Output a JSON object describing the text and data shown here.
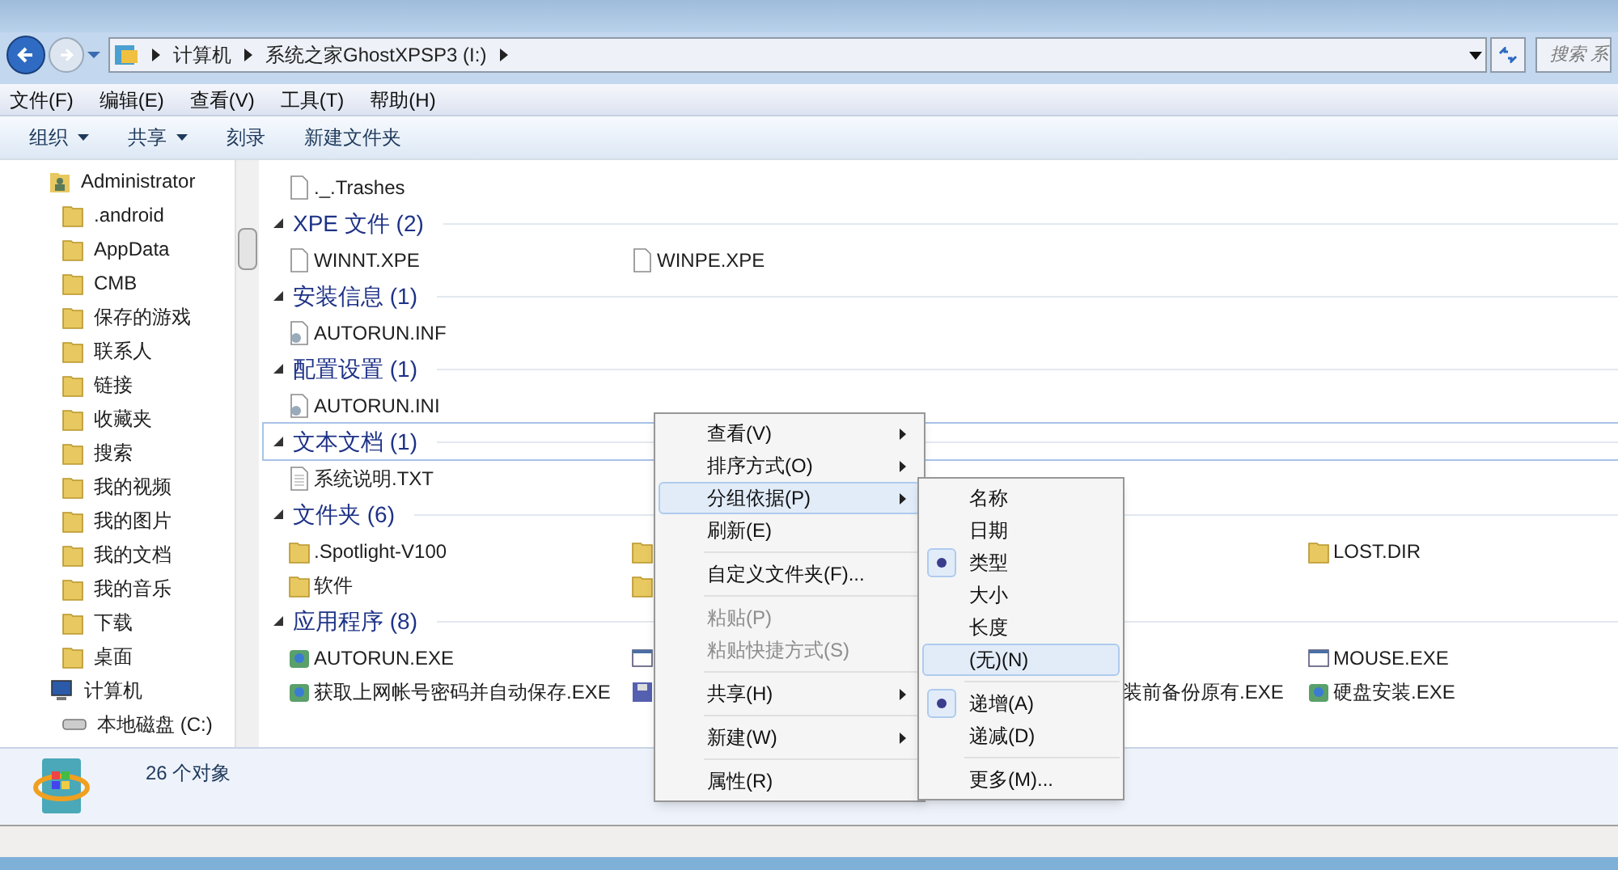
{
  "address_bar": {
    "crumbs": [
      "计算机",
      "系统之家GhostXPSP3 (I:)"
    ]
  },
  "search": {
    "placeholder": "搜索 系"
  },
  "menu_bar": [
    "文件(F)",
    "编辑(E)",
    "查看(V)",
    "工具(T)",
    "帮助(H)"
  ],
  "toolbar": [
    {
      "label": "组织",
      "dropdown": true
    },
    {
      "label": "共享",
      "dropdown": true
    },
    {
      "label": "刻录",
      "dropdown": false
    },
    {
      "label": "新建文件夹",
      "dropdown": false
    }
  ],
  "sidebar": {
    "items": [
      {
        "label": "Administrator",
        "kind": "user",
        "children": [
          {
            "label": ".android",
            "kind": "folder"
          },
          {
            "label": "AppData",
            "kind": "folder"
          },
          {
            "label": "CMB",
            "kind": "folder"
          },
          {
            "label": "保存的游戏",
            "kind": "folder"
          },
          {
            "label": "联系人",
            "kind": "folder"
          },
          {
            "label": "链接",
            "kind": "folder"
          },
          {
            "label": "收藏夹",
            "kind": "folder"
          },
          {
            "label": "搜索",
            "kind": "folder"
          },
          {
            "label": "我的视频",
            "kind": "folder"
          },
          {
            "label": "我的图片",
            "kind": "folder"
          },
          {
            "label": "我的文档",
            "kind": "folder"
          },
          {
            "label": "我的音乐",
            "kind": "folder"
          },
          {
            "label": "下载",
            "kind": "folder"
          },
          {
            "label": "桌面",
            "kind": "folder"
          }
        ]
      },
      {
        "label": "计算机",
        "kind": "computer",
        "children": [
          {
            "label": "本地磁盘 (C:)",
            "kind": "drive"
          }
        ]
      }
    ]
  },
  "top_rows": [
    [
      {
        "kind": "file",
        "name": "._.Trashes"
      }
    ]
  ],
  "groups": [
    {
      "title": "XPE 文件 (2)",
      "focused": false,
      "rows": [
        [
          {
            "kind": "file",
            "name": "WINNT.XPE"
          },
          {
            "kind": "file",
            "name": "WINPE.XPE"
          }
        ]
      ]
    },
    {
      "title": "安装信息 (1)",
      "focused": false,
      "rows": [
        [
          {
            "kind": "config",
            "name": "AUTORUN.INF"
          }
        ]
      ]
    },
    {
      "title": "配置设置 (1)",
      "focused": false,
      "rows": [
        [
          {
            "kind": "config",
            "name": "AUTORUN.INI"
          }
        ]
      ]
    },
    {
      "title": "文本文档 (1)",
      "focused": true,
      "rows": [
        [
          {
            "kind": "text",
            "name": "系统说明.TXT"
          }
        ]
      ]
    },
    {
      "title": "文件夹 (6)",
      "focused": false,
      "rows": [
        [
          {
            "kind": "folder",
            "name": ".Spotlight-V100"
          },
          {
            "kind": "folder"
          },
          "",
          {
            "kind": "folder",
            "name": "LOST.DIR"
          }
        ],
        [
          {
            "kind": "folder",
            "name": "软件"
          },
          {
            "kind": "folder"
          }
        ]
      ]
    },
    {
      "title": "应用程序 (8)",
      "focused": false,
      "rows": [
        [
          {
            "kind": "app",
            "name": "AUTORUN.EXE"
          },
          {
            "kind": "window"
          },
          "",
          {
            "kind": "window",
            "name": "MOUSE.EXE"
          }
        ],
        [
          {
            "kind": "app",
            "name": "获取上网帐号密码并自动保存.EXE"
          },
          {
            "kind": "disk"
          },
          {
            "kind": "label",
            "name": "装前备份原有.EXE"
          },
          {
            "kind": "app",
            "name": "硬盘安装.EXE"
          }
        ]
      ]
    }
  ],
  "context_menu": [
    {
      "kind": "item",
      "label": "查看(V)",
      "submenu": true,
      "disabled": false,
      "selected": false
    },
    {
      "kind": "item",
      "label": "排序方式(O)",
      "submenu": true,
      "disabled": false,
      "selected": false
    },
    {
      "kind": "item",
      "label": "分组依据(P)",
      "submenu": true,
      "disabled": false,
      "selected": true
    },
    {
      "kind": "item",
      "label": "刷新(E)",
      "submenu": false,
      "disabled": false,
      "selected": false
    },
    {
      "kind": "separator"
    },
    {
      "kind": "item",
      "label": "自定义文件夹(F)...",
      "submenu": false,
      "disabled": false,
      "selected": false
    },
    {
      "kind": "separator"
    },
    {
      "kind": "item",
      "label": "粘贴(P)",
      "submenu": false,
      "disabled": true,
      "selected": false
    },
    {
      "kind": "item",
      "label": "粘贴快捷方式(S)",
      "submenu": false,
      "disabled": true,
      "selected": false
    },
    {
      "kind": "separator"
    },
    {
      "kind": "item",
      "label": "共享(H)",
      "submenu": true,
      "disabled": false,
      "selected": false
    },
    {
      "kind": "separator"
    },
    {
      "kind": "item",
      "label": "新建(W)",
      "submenu": true,
      "disabled": false,
      "selected": false
    },
    {
      "kind": "separator"
    },
    {
      "kind": "item",
      "label": "属性(R)",
      "submenu": false,
      "disabled": false,
      "selected": false
    }
  ],
  "submenu": [
    {
      "kind": "item",
      "label": "名称",
      "checked": false,
      "selected": false
    },
    {
      "kind": "item",
      "label": "日期",
      "checked": false,
      "selected": false
    },
    {
      "kind": "item",
      "label": "类型",
      "checked": true,
      "selected": false
    },
    {
      "kind": "item",
      "label": "大小",
      "checked": false,
      "selected": false
    },
    {
      "kind": "item",
      "label": "长度",
      "checked": false,
      "selected": false
    },
    {
      "kind": "item",
      "label": "(无)(N)",
      "checked": false,
      "selected": true
    },
    {
      "kind": "separator"
    },
    {
      "kind": "item",
      "label": "递增(A)",
      "checked": true,
      "selected": false
    },
    {
      "kind": "item",
      "label": "递减(D)",
      "checked": false,
      "selected": false
    },
    {
      "kind": "separator"
    },
    {
      "kind": "item",
      "label": "更多(M)...",
      "checked": false,
      "selected": false
    }
  ],
  "status_bar": {
    "text": "26 个对象"
  }
}
